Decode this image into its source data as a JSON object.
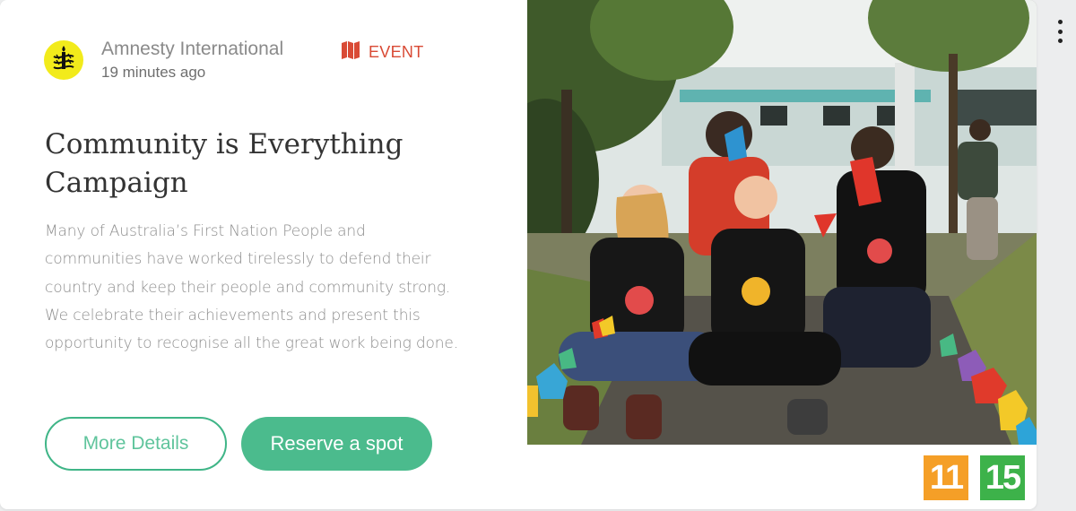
{
  "post": {
    "org_name": "Amnesty International",
    "time_ago": "19 minutes ago",
    "type_label": "EVENT",
    "title": "Community is Everything Campaign",
    "description": "Many of Australia’s First Nation People and communities have worked tirelessly to defend their country and keep their people and community strong. We celebrate their achievements and present this opportunity to recognise all the great work being done."
  },
  "actions": {
    "more_details_label": "More Details",
    "reserve_label": "Reserve a spot"
  },
  "sdg_goals": [
    {
      "number": "11",
      "color": "#f59f27"
    },
    {
      "number": "15",
      "color": "#3db24a"
    }
  ],
  "colors": {
    "accent_green": "#4bbb8d",
    "event_red": "#d94a35",
    "logo_yellow": "#f2eb1b"
  },
  "icons": {
    "org_logo": "amnesty-candle-logo",
    "event": "map-icon",
    "menu": "kebab-menu-icon"
  }
}
